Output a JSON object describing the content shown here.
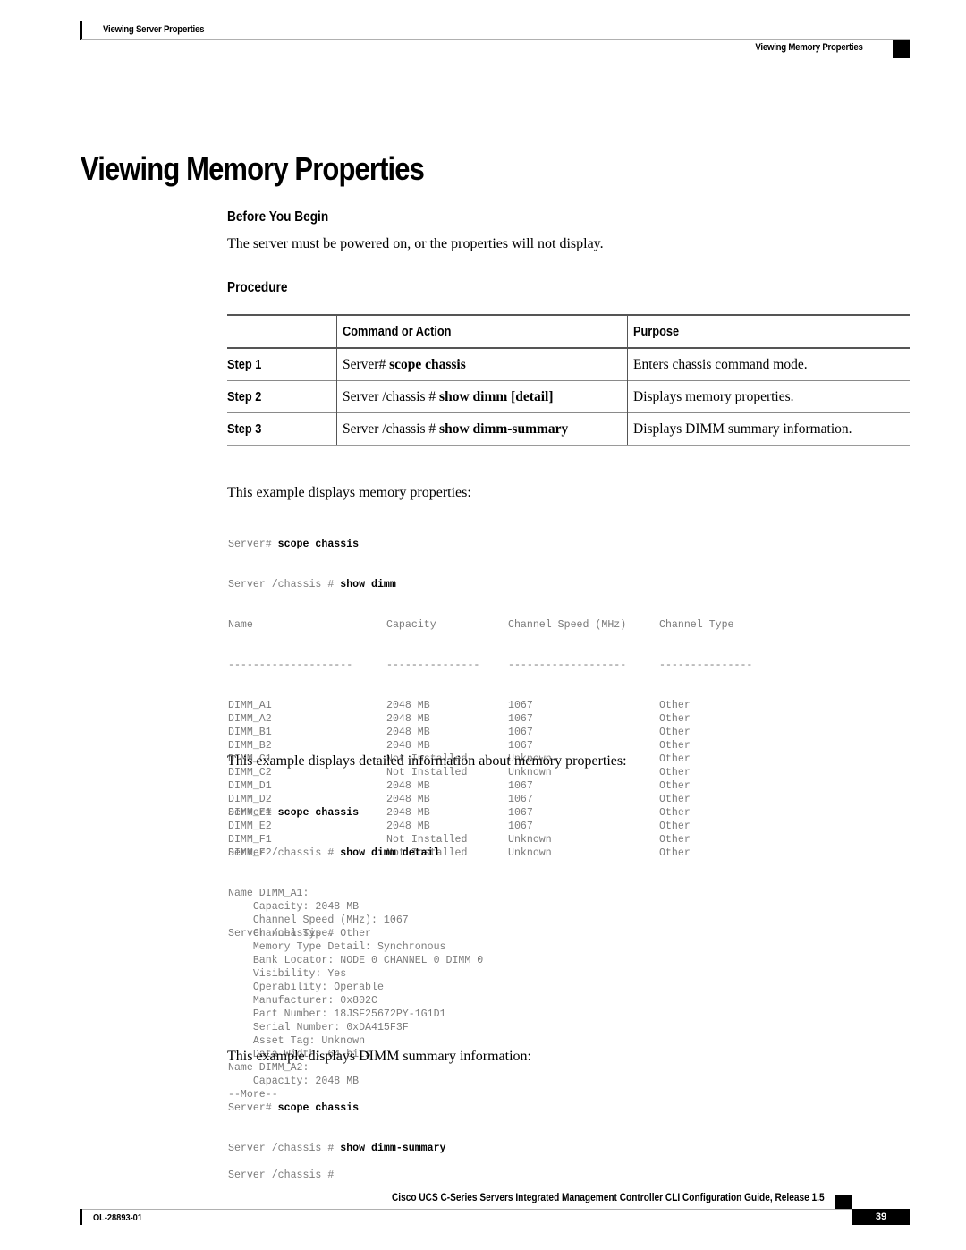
{
  "header": {
    "chapter": "Viewing Server Properties",
    "section": "Viewing Memory Properties"
  },
  "title": "Viewing Memory Properties",
  "before_you_begin": {
    "heading": "Before You Begin",
    "text": "The server must be powered on, or the properties will not display."
  },
  "procedure": {
    "heading": "Procedure",
    "columns": [
      "",
      "Command or Action",
      "Purpose"
    ],
    "steps": [
      {
        "step": "Step 1",
        "prompt": "Server# ",
        "command": "scope chassis",
        "purpose": "Enters chassis command mode."
      },
      {
        "step": "Step 2",
        "prompt": "Server /chassis # ",
        "command": "show dimm [detail]",
        "purpose": "Displays memory properties."
      },
      {
        "step": "Step 3",
        "prompt": "Server /chassis # ",
        "command": "show dimm-summary",
        "purpose": "Displays DIMM summary information."
      }
    ]
  },
  "example1": {
    "intro": "This example displays memory properties:",
    "line1_prompt": "Server# ",
    "line1_cmd": "scope chassis",
    "line2_prompt": "Server /chassis # ",
    "line2_cmd": "show dimm",
    "headers": [
      "Name",
      "Capacity",
      "Channel Speed (MHz)",
      "Channel Type"
    ],
    "separators": [
      "--------------------",
      "---------------",
      "-------------------",
      "---------------"
    ],
    "rows": [
      [
        "DIMM_A1",
        "2048 MB",
        "1067",
        "Other"
      ],
      [
        "DIMM_A2",
        "2048 MB",
        "1067",
        "Other"
      ],
      [
        "DIMM_B1",
        "2048 MB",
        "1067",
        "Other"
      ],
      [
        "DIMM_B2",
        "2048 MB",
        "1067",
        "Other"
      ],
      [
        "DIMM_C1",
        "Not Installed",
        "Unknown",
        "Other"
      ],
      [
        "DIMM_C2",
        "Not Installed",
        "Unknown",
        "Other"
      ],
      [
        "DIMM_D1",
        "2048 MB",
        "1067",
        "Other"
      ],
      [
        "DIMM_D2",
        "2048 MB",
        "1067",
        "Other"
      ],
      [
        "DIMM_E1",
        "2048 MB",
        "1067",
        "Other"
      ],
      [
        "DIMM_E2",
        "2048 MB",
        "1067",
        "Other"
      ],
      [
        "DIMM_F1",
        "Not Installed",
        "Unknown",
        "Other"
      ],
      [
        "DIMM_F2",
        "Not Installed",
        "Unknown",
        "Other"
      ]
    ],
    "end_prompt": "Server /chassis #"
  },
  "example2": {
    "intro": "This example displays detailed information about memory properties:",
    "line1_prompt": "Server# ",
    "line1_cmd": "scope chassis",
    "line2_prompt": "Server /chassis # ",
    "line2_cmd": "show dimm detail",
    "output": [
      "Name DIMM_A1:",
      "    Capacity: 2048 MB",
      "    Channel Speed (MHz): 1067",
      "    Channel Type: Other",
      "    Memory Type Detail: Synchronous",
      "    Bank Locator: NODE 0 CHANNEL 0 DIMM 0",
      "    Visibility: Yes",
      "    Operability: Operable",
      "    Manufacturer: 0x802C",
      "    Part Number: 18JSF25672PY-1G1D1",
      "    Serial Number: 0xDA415F3F",
      "    Asset Tag: Unknown",
      "    Data Width: 64 bits",
      "Name DIMM_A2:",
      "    Capacity: 2048 MB",
      "--More--"
    ],
    "end_prompt": "Server /chassis #"
  },
  "example3": {
    "intro": "This example displays DIMM summary information:",
    "line1_prompt": "Server# ",
    "line1_cmd": "scope chassis",
    "line2_prompt": "Server /chassis # ",
    "line2_cmd": "show dimm-summary"
  },
  "footer": {
    "guide_title": "Cisco UCS C-Series Servers Integrated Management Controller CLI Configuration Guide, Release 1.5",
    "doc_number": "OL-28893-01",
    "page_number": "39"
  }
}
